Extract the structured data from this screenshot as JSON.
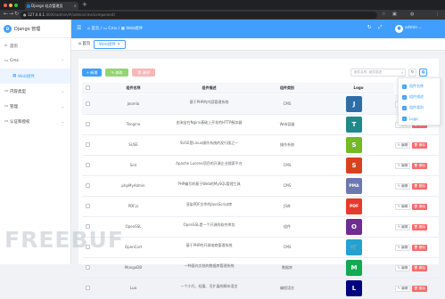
{
  "browser": {
    "tab_title": "Django 站点管理员",
    "url_host": "127.0.0.1",
    "url_path": ":8000/admin/#/admin/cms/component/"
  },
  "sidebar": {
    "brand": "Django 管理",
    "items": [
      {
        "label": "首页",
        "icon": "home-icon"
      },
      {
        "label": "Cms",
        "icon": "folder-icon",
        "expanded": true
      },
      {
        "label": "Web组件",
        "icon": "grid-icon",
        "active": true
      },
      {
        "label": "内容类型",
        "icon": "folder-icon"
      },
      {
        "label": "管理",
        "icon": "folder-icon"
      },
      {
        "label": "认证和授权",
        "icon": "folder-icon"
      }
    ]
  },
  "header": {
    "crumbs": [
      {
        "label": "首页",
        "icon": "home-icon"
      },
      {
        "label": "Cms",
        "icon": "folder-icon"
      },
      {
        "label": "Web组件",
        "icon": "grid-icon"
      }
    ],
    "user": "admin"
  },
  "page_tabs": [
    {
      "label": "首页",
      "icon": "home-icon"
    },
    {
      "label": "Web组件",
      "active": true
    }
  ],
  "toolbar": {
    "add_label": "+ 新增",
    "btn2_label": "修改",
    "btn3_label": "删除",
    "search_placeholder": "组件名称, 组件描述"
  },
  "table": {
    "columns": [
      "组件名称",
      "组件描述",
      "组件类别",
      "Logo"
    ],
    "rows": [
      {
        "name": "Joomla",
        "desc": "基于PHP的内容管理系统",
        "category": "CMS",
        "logo_color": "#2d6ea8",
        "logo_text": "J"
      },
      {
        "name": "Tengine",
        "desc": "由淘宝在Nginx基础上开发的HTTP服务器",
        "category": "Web容器",
        "logo_color": "#1e8a8a",
        "logo_text": "T"
      },
      {
        "name": "SUSE",
        "desc": "SUSE是Linux操作系统的发行版之一",
        "category": "操作系统",
        "logo_color": "#73ba25",
        "logo_text": "S"
      },
      {
        "name": "Solr",
        "desc": "Apache Lucene项目的开源企业搜索平台",
        "category": "CMS",
        "logo_color": "#d9411e",
        "logo_text": "S"
      },
      {
        "name": "phpMyAdmin",
        "desc": "PHP编写的基于Web的MySQL管理工具",
        "category": "CMS",
        "logo_color": "#6c78af",
        "logo_text": "PMA"
      },
      {
        "name": "PDF.js",
        "desc": "渲染PDF文件的JavaScript库",
        "category": "JS库",
        "logo_color": "#e33b2e",
        "logo_text": "PDF"
      },
      {
        "name": "OpenSSL",
        "desc": "OpenSSL是一个开源的软件库包",
        "category": "组件",
        "logo_color": "#6f2c91",
        "logo_text": "O"
      },
      {
        "name": "OpenCart",
        "desc": "基于PHP的开源电商管理系统",
        "category": "CMS",
        "logo_color": "#23a1d1",
        "logo_text": "🛒"
      },
      {
        "name": "MongoDB",
        "desc": "一种面向文档的数据库管理系统",
        "category": "数据库",
        "logo_color": "#13aa52",
        "logo_text": "M"
      },
      {
        "name": "Lua",
        "desc": "一个小巧、轻量、可扩展的脚本语言",
        "category": "编程语言",
        "logo_color": "#00007f",
        "logo_text": "L"
      }
    ],
    "edit_label": "编辑",
    "delete_label": "删除"
  },
  "column_panel": {
    "options": [
      "组件名称",
      "组件描述",
      "组件类别",
      "Logo"
    ]
  },
  "watermark": "FREEBUF",
  "colors": {
    "primary": "#409eff",
    "success": "#67c23a",
    "danger": "#f56c6c"
  }
}
